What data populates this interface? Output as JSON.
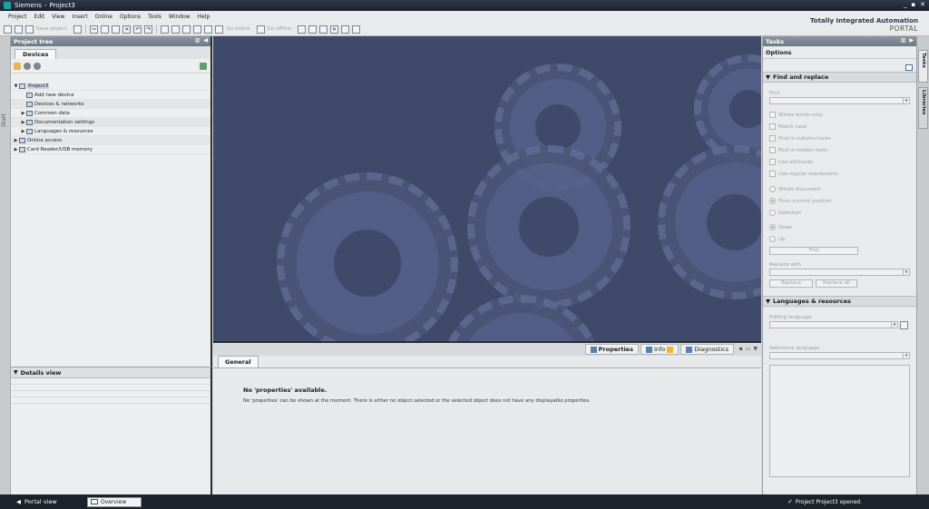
{
  "window": {
    "app": "Siemens",
    "separator": "-",
    "project": "Project3",
    "controls": [
      "_",
      "▪",
      "✕"
    ]
  },
  "menu": [
    "Project",
    "Edit",
    "View",
    "Insert",
    "Online",
    "Options",
    "Tools",
    "Window",
    "Help"
  ],
  "toolbar": {
    "save_project": "Save project",
    "go_online": "Go online",
    "go_offline": "Go offline"
  },
  "brand": {
    "line1": "Totally Integrated Automation",
    "line2": "PORTAL"
  },
  "start_strip": "Start",
  "project_tree": {
    "title": "Project tree",
    "tab": "Devices",
    "items": [
      {
        "label": "Project3",
        "arrow": "▼",
        "level": 0
      },
      {
        "label": "Add new device",
        "arrow": "",
        "level": 1
      },
      {
        "label": "Devices & networks",
        "arrow": "",
        "level": 1
      },
      {
        "label": "Common data",
        "arrow": "▶",
        "level": 1
      },
      {
        "label": "Documentation settings",
        "arrow": "▶",
        "level": 1
      },
      {
        "label": "Languages & resources",
        "arrow": "▶",
        "level": 1
      },
      {
        "label": "Online access",
        "arrow": "▶",
        "level": 0
      },
      {
        "label": "Card Reader/USB memory",
        "arrow": "▶",
        "level": 0
      }
    ]
  },
  "details_view": {
    "title": "Details view"
  },
  "inspector": {
    "tabs": {
      "properties": "Properties",
      "info": "Info",
      "diagnostics": "Diagnostics"
    },
    "subtab": "General",
    "message_title": "No 'properties' available.",
    "message_text": "No 'properties' can be shown at the moment. There is either no object selected or the selected object does not have any displayable properties."
  },
  "tasks": {
    "title": "Tasks",
    "options": "Options",
    "find_replace": {
      "title": "Find and replace",
      "find_label": "Find",
      "checkboxes": [
        "Whole words only",
        "Match case",
        "Find in substructures",
        "Find in hidden texts",
        "Use wildcards",
        "Use regular expressions"
      ],
      "scope": [
        "Whole document",
        "From current position",
        "Selection"
      ],
      "direction": [
        "Down",
        "Up"
      ],
      "find_button": "Find",
      "replace_label": "Replace with",
      "replace_button": "Replace",
      "replace_all_button": "Replace all"
    },
    "languages": {
      "title": "Languages & resources",
      "editing_label": "Editing language",
      "reference_label": "Reference language"
    }
  },
  "right_tabs": [
    "Tasks",
    "Libraries"
  ],
  "statusbar": {
    "portal_view": "Portal view",
    "overview": "Overview",
    "message": "Project Project3 opened."
  }
}
